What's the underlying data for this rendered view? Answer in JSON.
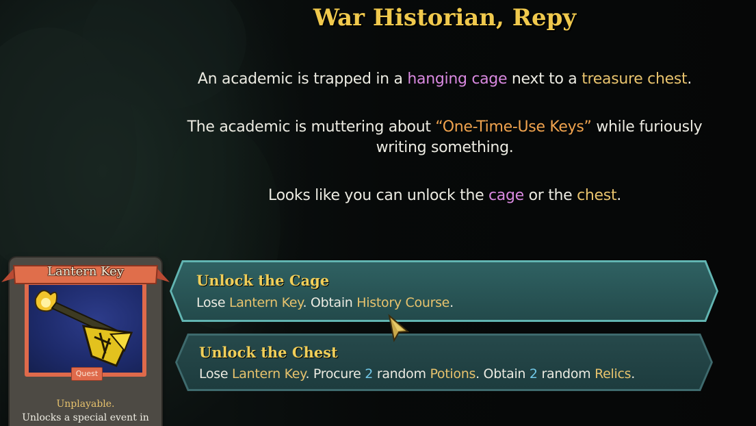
{
  "event": {
    "title": "War Historian, Repy",
    "p1": {
      "a": "An academic is trapped in a ",
      "b": "hanging cage",
      "c": " next to a ",
      "d": "treasure chest",
      "e": "."
    },
    "p2": {
      "a": "The academic is muttering about ",
      "b": "“One-Time-Use Keys”",
      "c": " while furiously writing something."
    },
    "p3": {
      "a": "Looks like you can unlock the ",
      "b": "cage",
      "c": " or the ",
      "d": "chest",
      "e": "."
    }
  },
  "options": [
    {
      "title": "Unlock the Cage",
      "desc": {
        "a": "Lose ",
        "b": "Lantern Key",
        "c": ". Obtain ",
        "d": "History Course",
        "e": "."
      }
    },
    {
      "title": "Unlock the Chest",
      "desc": {
        "a": "Lose ",
        "b": "Lantern Key",
        "c": ". Procure ",
        "d": "2",
        "e": " random ",
        "f": "Potions",
        "g": ". Obtain ",
        "h": "2",
        "i": " random ",
        "j": "Relics",
        "k": "."
      }
    }
  ],
  "card": {
    "name": "Lantern Key",
    "type": "Quest",
    "desc_line1": "Unplayable.",
    "desc_line2": "Unlocks a special event in"
  },
  "colors": {
    "title": "#f0c94d",
    "highlight_purple": "#d989e0",
    "highlight_gold": "#e8c36d",
    "highlight_orange": "#f0a34e",
    "number_blue": "#71c8e8",
    "option_border": "#62b5b2",
    "card_frame": "#df6a4b"
  },
  "icons": {
    "cursor": "arrow-cursor-icon",
    "card_art": "lantern-key-icon"
  }
}
